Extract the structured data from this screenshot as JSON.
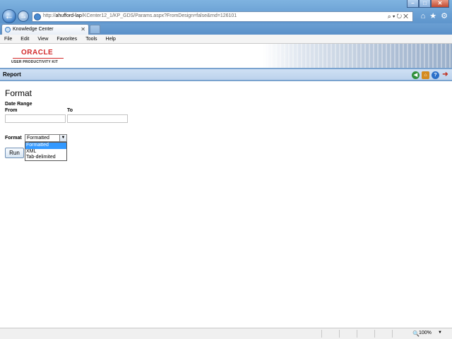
{
  "browser": {
    "address_prefix": "http://",
    "address_host": "ahufford-lap",
    "address_path": "/KCenter12_1/KP_GDS/Params.aspx?FromDesign=false&rnd=126101",
    "tab_title": "Knowledge Center",
    "menu": [
      "File",
      "Edit",
      "View",
      "Favorites",
      "Tools",
      "Help"
    ],
    "zoom": "100%"
  },
  "header": {
    "logo_brand": "ORACLE",
    "logo_product": "USER PRODUCTIVITY KIT",
    "brand_color": "#d2292a"
  },
  "report_bar": {
    "title": "Report",
    "icons": [
      "back-icon",
      "home-icon",
      "help-icon",
      "exit-icon"
    ]
  },
  "form": {
    "title": "Format",
    "date_range_label": "Date Range",
    "from_label": "From",
    "to_label": "To",
    "from_value": "",
    "to_value": "",
    "format_label": "Format",
    "format_selected": "Formatted",
    "format_options": [
      "Formatted",
      "XML",
      "Tab-delimited"
    ],
    "run_label": "Run"
  }
}
